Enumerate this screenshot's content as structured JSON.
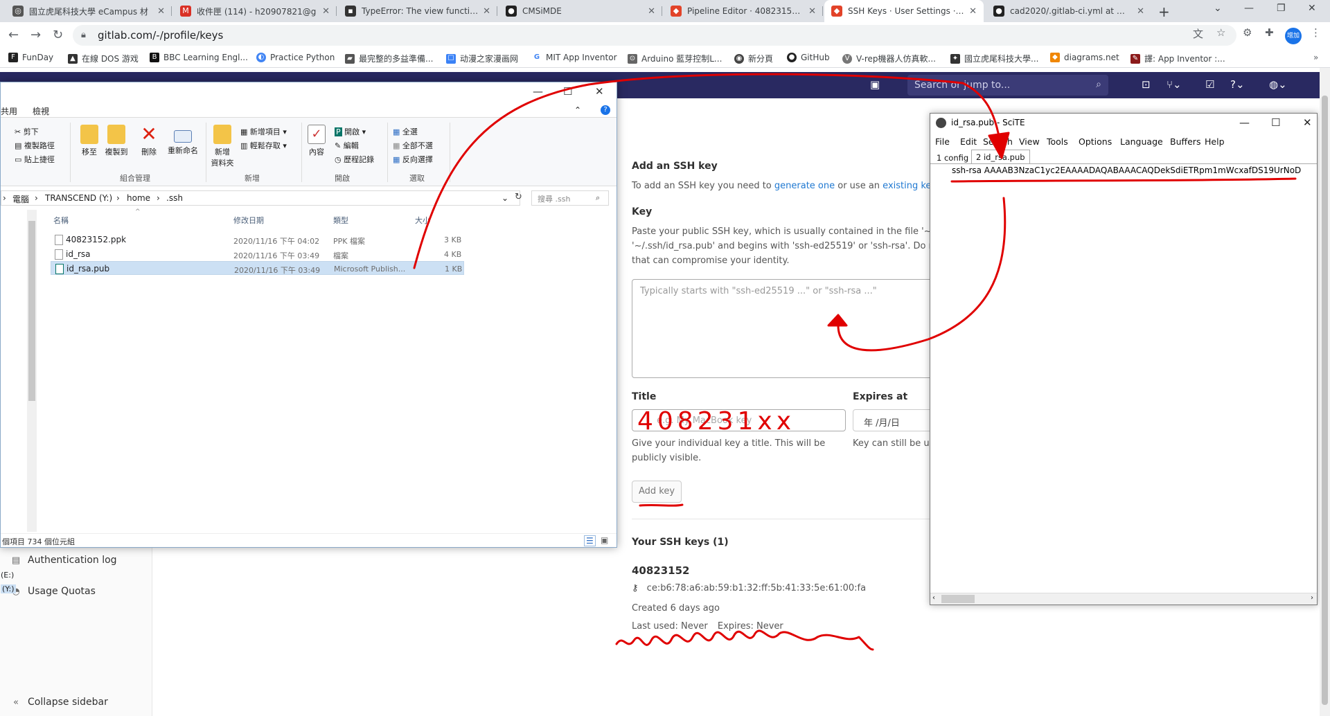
{
  "browser": {
    "tabs": [
      {
        "title": "國立虎尾科技大學 eCampus 材",
        "icon_color": "#555555"
      },
      {
        "title": "收件匣 (114) - h20907821@g",
        "icon_color": "#d93025"
      },
      {
        "title": "TypeError: The view function d",
        "icon_color": "#333333"
      },
      {
        "title": "CMSiMDE",
        "icon_color": "#222222"
      },
      {
        "title": "Pipeline Editor · 40823152 / ca",
        "icon_color": "#e24329"
      },
      {
        "title": "SSH Keys · User Settings · GitLa",
        "icon_color": "#e24329"
      },
      {
        "title": "cad2020/.gitlab-ci.yml at mast",
        "icon_color": "#222222"
      }
    ],
    "url": "gitlab.com/-/profile/keys",
    "profile_label": "增加",
    "bookmarks": [
      {
        "label": "FunDay",
        "color": "#222222"
      },
      {
        "label": "在線 DOS 游戏",
        "color": "#333333"
      },
      {
        "label": "BBC Learning Engl...",
        "color": "#111111"
      },
      {
        "label": "Practice Python",
        "color": "#4285f4"
      },
      {
        "label": "最完整的多益準備...",
        "color": "#555555"
      },
      {
        "label": "动漫之家漫画网",
        "color": "#3b82f6"
      },
      {
        "label": "MIT App Inventor",
        "color": "#4285f4"
      },
      {
        "label": "Arduino 藍芽控制L...",
        "color": "#666666"
      },
      {
        "label": "新分頁",
        "color": "#444444"
      },
      {
        "label": "GitHub",
        "color": "#222222"
      },
      {
        "label": "V-rep機器人仿真軟...",
        "color": "#777777"
      },
      {
        "label": "國立虎尾科技大學...",
        "color": "#333333"
      },
      {
        "label": "diagrams.net",
        "color": "#f08705"
      },
      {
        "label": "譯: App Inventor :...",
        "color": "#8b1a1a"
      }
    ]
  },
  "gitlab": {
    "search_placeholder": "Search or jump to...",
    "sidebar": {
      "auth_log": "Authentication log",
      "usage_quotas": "Usage Quotas",
      "collapse": "Collapse sidebar"
    },
    "add_ssh_heading": "Add an SSH key",
    "add_ssh_intro_prefix": "To add an SSH key you need to",
    "link_generate": "generate one",
    "add_ssh_or": "or use an",
    "link_existing": "existing key",
    "key_label": "Key",
    "key_help_line1": "Paste your public SSH key, which is usually contained in the file '~/.ssh",
    "key_help_line2": "'~/.ssh/id_rsa.pub' and begins with 'ssh-ed25519' or 'ssh-rsa'. Do not p",
    "key_help_line3": "that can compromise your identity.",
    "key_placeholder": "Typically starts with \"ssh-ed25519 ...\" or \"ssh-rsa ...\"",
    "title_label": "Title",
    "title_placeholder": "e.g. My MacBook key",
    "title_help_line1": "Give your individual key a title. This will be",
    "title_help_line2": "publicly visible.",
    "expires_label": "Expires at",
    "expires_value": "年 /月/日",
    "expires_help": "Key can still be us",
    "add_key_button": "Add key",
    "your_keys_heading": "Your SSH keys (1)",
    "key_name": "40823152",
    "fingerprint": "ce:b6:78:a6:ab:59:b1:32:ff:5b:41:33:5e:61:00:fa",
    "created": "Created 6 days ago",
    "last_used": "Last used: Never",
    "expires": "Expires: Never"
  },
  "explorer": {
    "menu_share": "共用",
    "menu_view": "檢視",
    "ribbon": {
      "cut": "剪下",
      "copy_path": "複製路徑",
      "paste_shortcut": "貼上捷徑",
      "move_to": "移至",
      "copy_to": "複製到",
      "delete": "刪除",
      "rename": "重新命名",
      "new_folder_l1": "新增",
      "new_folder_l2": "資料夾",
      "new_item": "新增項目",
      "easy_access": "輕鬆存取",
      "properties": "內容",
      "open": "開啟",
      "edit": "編輯",
      "history": "歷程記錄",
      "select_all": "全選",
      "select_none": "全部不選",
      "invert_selection": "反向選擇",
      "group_organize": "組合管理",
      "group_new": "新增",
      "group_open": "開啟",
      "group_select": "選取"
    },
    "path": [
      "電腦",
      "TRANSCEND (Y:)",
      "home",
      ".ssh"
    ],
    "search_placeholder": "搜尋 .ssh",
    "columns": {
      "name": "名稱",
      "date": "修改日期",
      "type": "類型",
      "size": "大小"
    },
    "files": [
      {
        "name": "40823152.ppk",
        "date": "2020/11/16 下午 04:02",
        "type": "PPK 檔案",
        "size": "3 KB"
      },
      {
        "name": "id_rsa",
        "date": "2020/11/16 下午 03:49",
        "type": "檔案",
        "size": "4 KB"
      },
      {
        "name": "id_rsa.pub",
        "date": "2020/11/16 下午 03:49",
        "type": "Microsoft Publish...",
        "size": "1 KB"
      }
    ],
    "drive_e": "(E:)",
    "drive_y": "(Y:)",
    "status": "個項目  734 個位元組"
  },
  "scite": {
    "title": "id_rsa.pub - SciTE",
    "menu": [
      "File",
      "Edit",
      "Search",
      "View",
      "Tools",
      "Options",
      "Language",
      "Buffers",
      "Help"
    ],
    "tab1": "1 config",
    "tab2": "2 id_rsa.pub",
    "content": "ssh-rsa AAAAB3NzaC1yc2EAAAADAQABAAACAQDekSdiETRpm1mWcxafDS19UrNoD"
  },
  "annotations": {
    "handwritten_title": "408231xx",
    "stroke_color": "#e00000"
  }
}
